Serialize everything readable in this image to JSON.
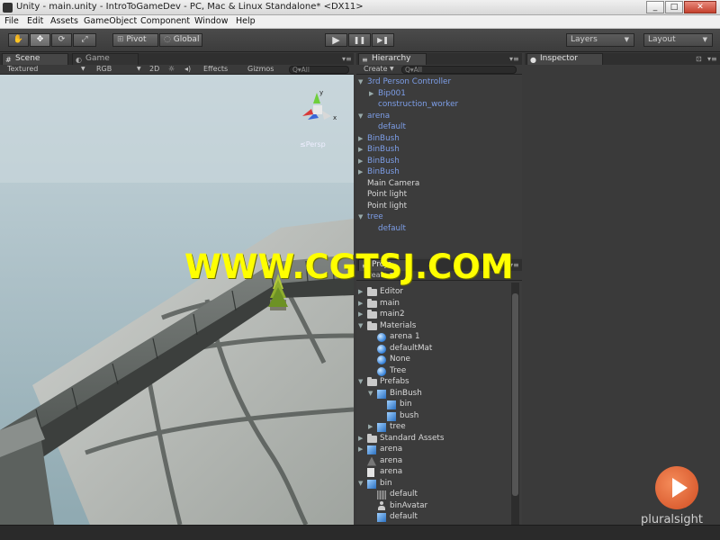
{
  "window": {
    "title": "Unity - main.unity - IntroToGameDev - PC, Mac & Linux Standalone* <DX11>",
    "min_label": "_",
    "max_label": "□",
    "close_label": "✕"
  },
  "menu": [
    "File",
    "Edit",
    "Assets",
    "GameObject",
    "Component",
    "Window",
    "Help"
  ],
  "toolbar": {
    "tools": [
      "hand-tool",
      "move-tool",
      "rotate-tool",
      "scale-tool"
    ],
    "pivot_label": "Pivot",
    "global_label": "Global",
    "play_icon": "▶",
    "pause_icon": "❚❚",
    "step_icon": "▶❚",
    "layers_label": "Layers",
    "layout_label": "Layout"
  },
  "scene_panel": {
    "tabs": [
      {
        "label": "Scene",
        "icon": "#"
      },
      {
        "label": "Game",
        "icon": "◐"
      }
    ],
    "bar": {
      "shading": "Textured",
      "render": "RGB",
      "mode2d": "2D",
      "lighting_icon": "☼",
      "audio_icon": "◂)",
      "effects": "Effects",
      "gizmos": "Gizmos",
      "search_placeholder": "Q▾All"
    },
    "gizmo": {
      "y_label": "y",
      "x_label": "x",
      "persp_label": "≤Persp"
    }
  },
  "hierarchy": {
    "tab_label": "Hierarchy",
    "create_label": "Create",
    "search_placeholder": "Q▾All",
    "items": [
      {
        "label": "3rd Person Controller",
        "depth": 0,
        "arrow": "▼",
        "color": "blue"
      },
      {
        "label": "Bip001",
        "depth": 1,
        "arrow": "▶",
        "color": "blue"
      },
      {
        "label": "construction_worker",
        "depth": 1,
        "arrow": "",
        "color": "blue"
      },
      {
        "label": "arena",
        "depth": 0,
        "arrow": "▼",
        "color": "blue"
      },
      {
        "label": "default",
        "depth": 1,
        "arrow": "",
        "color": "blue"
      },
      {
        "label": "BinBush",
        "depth": 0,
        "arrow": "▶",
        "color": "blue"
      },
      {
        "label": "BinBush",
        "depth": 0,
        "arrow": "▶",
        "color": "blue"
      },
      {
        "label": "BinBush",
        "depth": 0,
        "arrow": "▶",
        "color": "blue"
      },
      {
        "label": "BinBush",
        "depth": 0,
        "arrow": "▶",
        "color": "blue"
      },
      {
        "label": "Main Camera",
        "depth": 0,
        "arrow": "",
        "color": "white"
      },
      {
        "label": "Point light",
        "depth": 0,
        "arrow": "",
        "color": "white"
      },
      {
        "label": "Point light",
        "depth": 0,
        "arrow": "",
        "color": "white"
      },
      {
        "label": "tree",
        "depth": 0,
        "arrow": "▼",
        "color": "blue"
      },
      {
        "label": "default",
        "depth": 1,
        "arrow": "",
        "color": "blue"
      }
    ]
  },
  "project": {
    "tab_label": "Proje",
    "create_label": "Create",
    "items": [
      {
        "label": "Editor",
        "depth": 0,
        "arrow": "▶",
        "icon": "folder"
      },
      {
        "label": "main",
        "depth": 0,
        "arrow": "▶",
        "icon": "folder"
      },
      {
        "label": "main2",
        "depth": 0,
        "arrow": "▶",
        "icon": "folder"
      },
      {
        "label": "Materials",
        "depth": 0,
        "arrow": "▼",
        "icon": "folder"
      },
      {
        "label": "arena 1",
        "depth": 1,
        "arrow": "",
        "icon": "sphere"
      },
      {
        "label": "defaultMat",
        "depth": 1,
        "arrow": "",
        "icon": "sphere"
      },
      {
        "label": "None",
        "depth": 1,
        "arrow": "",
        "icon": "sphere"
      },
      {
        "label": "Tree",
        "depth": 1,
        "arrow": "",
        "icon": "sphere"
      },
      {
        "label": "Prefabs",
        "depth": 0,
        "arrow": "▼",
        "icon": "folder"
      },
      {
        "label": "BinBush",
        "depth": 1,
        "arrow": "▼",
        "icon": "cube"
      },
      {
        "label": "bin",
        "depth": 2,
        "arrow": "",
        "icon": "cube"
      },
      {
        "label": "bush",
        "depth": 2,
        "arrow": "",
        "icon": "cube"
      },
      {
        "label": "tree",
        "depth": 1,
        "arrow": "▶",
        "icon": "cube"
      },
      {
        "label": "Standard Assets",
        "depth": 0,
        "arrow": "▶",
        "icon": "folder"
      },
      {
        "label": "arena",
        "depth": 0,
        "arrow": "▶",
        "icon": "cube"
      },
      {
        "label": "arena",
        "depth": 0,
        "arrow": "",
        "icon": "mesh"
      },
      {
        "label": "arena",
        "depth": 0,
        "arrow": "",
        "icon": "doc"
      },
      {
        "label": "bin",
        "depth": 0,
        "arrow": "▼",
        "icon": "cube"
      },
      {
        "label": "default",
        "depth": 1,
        "arrow": "",
        "icon": "grid"
      },
      {
        "label": "binAvatar",
        "depth": 1,
        "arrow": "",
        "icon": "person"
      },
      {
        "label": "default",
        "depth": 1,
        "arrow": "",
        "icon": "cube"
      }
    ]
  },
  "inspector": {
    "tab_label": "Inspector",
    "lock_icon": "🔒"
  },
  "overlay": {
    "watermark": "WWW.CGTSJ.COM",
    "brand": "pluralsight"
  },
  "colors": {
    "accent_blue": "#7d9ee8",
    "watermark_yellow": "#ffff00",
    "brand_orange": "#e0622f"
  }
}
